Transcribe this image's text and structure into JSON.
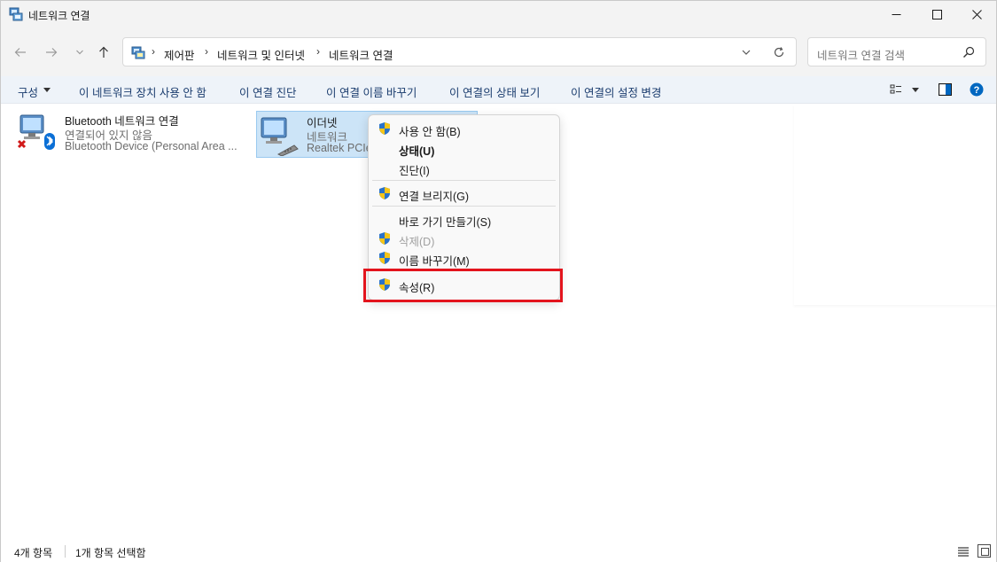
{
  "window": {
    "title": "네트워크 연결",
    "controls": {
      "minimize_icon": "minimize-icon",
      "maximize_icon": "maximize-icon",
      "close_icon": "close-icon"
    }
  },
  "nav": {
    "breadcrumbs": [
      "제어판",
      "네트워크 및 인터넷",
      "네트워크 연결"
    ],
    "search_placeholder": "네트워크 연결 검색"
  },
  "commandbar": {
    "organize": "구성",
    "commands": [
      "이 네트워크 장치 사용 안 함",
      "이 연결 진단",
      "이 연결 이름 바꾸기",
      "이 연결의 상태 보기",
      "이 연결의 설정 변경"
    ]
  },
  "items": [
    {
      "name": "Bluetooth 네트워크 연결",
      "status": "연결되어 있지 않음",
      "device": "Bluetooth Device (Personal Area ..."
    },
    {
      "name": "이더넷",
      "status": "네트워크",
      "device": "Realtek PCIe"
    }
  ],
  "context_menu": {
    "items": [
      {
        "label": "사용 안 함(B)",
        "shield": true,
        "bold": false,
        "disabled": false
      },
      {
        "label": "상태(U)",
        "shield": false,
        "bold": true,
        "disabled": false
      },
      {
        "label": "진단(I)",
        "shield": false,
        "bold": false,
        "disabled": false
      },
      {
        "label": "연결 브리지(G)",
        "shield": true,
        "bold": false,
        "disabled": false
      },
      {
        "label": "바로 가기 만들기(S)",
        "shield": false,
        "bold": false,
        "disabled": false
      },
      {
        "label": "삭제(D)",
        "shield": true,
        "bold": false,
        "disabled": true
      },
      {
        "label": "이름 바꾸기(M)",
        "shield": true,
        "bold": false,
        "disabled": false
      },
      {
        "label": "속성(R)",
        "shield": true,
        "bold": false,
        "disabled": false
      }
    ],
    "highlighted_item": "속성(R)",
    "highlight_color": "#e3141d"
  },
  "statusbar": {
    "item_count": "4개 항목",
    "selected_count": "1개 항목 선택함"
  },
  "colors": {
    "accent": "#0067c0",
    "selection_bg": "#cce4f7",
    "commandbar_bg": "#eef3f9"
  }
}
